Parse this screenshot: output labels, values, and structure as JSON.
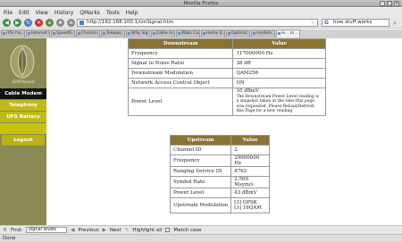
{
  "window": {
    "title": "Mozilla Firefox"
  },
  "menu": [
    "File",
    "Edit",
    "View",
    "History",
    "QMarks",
    "Tools",
    "Help"
  ],
  "nav": {
    "url": "http://192.168.100.1/cmSignal.htm",
    "search_value": "how stuff works"
  },
  "tabs": [
    "rifle fro...",
    "Internet Fi...",
    "SpeedG...",
    "Checkin...",
    "Telepos...",
    "Why Sig...",
    "Cable m...",
    "Walls Ca...",
    "Home E...",
    "Optimiz...",
    "modem...",
    "le... m..."
  ],
  "sidebar": {
    "logo_text": "SURFboard",
    "items": [
      "Cable Modem",
      "Telephony",
      "UPS Battery"
    ],
    "logout": "Logout"
  },
  "downstream": {
    "headers": [
      "Downstream",
      "Value"
    ],
    "rows": [
      {
        "label": "Frequency",
        "value": "117000000 Hz"
      },
      {
        "label": "Signal to Noise Ratio",
        "value": "38 dB"
      },
      {
        "label": "Downstream Modulation",
        "value": "QAM256"
      },
      {
        "label": "Network Access Control Object",
        "value": "ON"
      }
    ],
    "power_label": "Power Level",
    "power_value": "10 dBmV",
    "power_note": "The Downstream Power Level reading is a snapshot taken at the time this page was requested. Please Reload/Refresh this Page for a new reading"
  },
  "upstream": {
    "headers": [
      "Upstream",
      "Value"
    ],
    "rows": [
      {
        "label": "Channel ID",
        "value": "2"
      },
      {
        "label": "Frequency",
        "value": "29000000 Hz"
      },
      {
        "label": "Ranging Service ID",
        "value": "8762"
      },
      {
        "label": "Symbol Rate",
        "value": "2.560 Msym/s"
      },
      {
        "label": "Power Level",
        "value": "43 dBmV"
      }
    ],
    "mod_label": "Upstream Modulation",
    "mod_values": [
      "[3] QPSK",
      "[3] 16QAM"
    ]
  },
  "findbar": {
    "label": "Find:",
    "value": "signal levels",
    "previous": "Previous",
    "next": "Next",
    "highlight": "Highlight all",
    "match_case": "Match case"
  },
  "status": {
    "text": "Done"
  },
  "colors": {
    "sidebar": "#8a8a55",
    "nav_button": "#c0ba18",
    "nav_active": "#121212",
    "table_header": "#8a7332"
  }
}
